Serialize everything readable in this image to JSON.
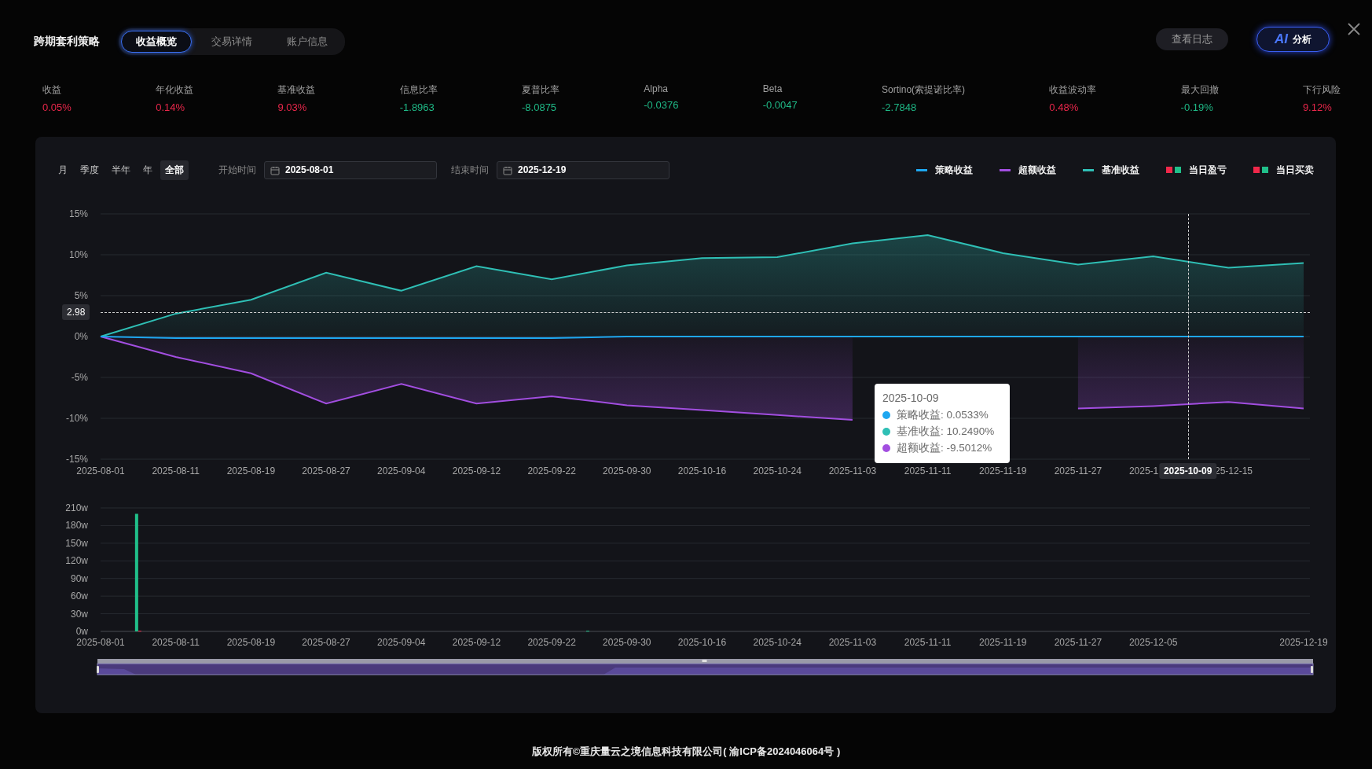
{
  "header": {
    "title": "跨期套利策略",
    "tabs": [
      {
        "label": "收益概览",
        "selected": true
      },
      {
        "label": "交易详情",
        "selected": false
      },
      {
        "label": "账户信息",
        "selected": false
      }
    ],
    "log_button": "查看日志",
    "ai_button": {
      "badge": "AI",
      "label": "分析"
    }
  },
  "stats": [
    {
      "label": "收益",
      "value": "0.05%",
      "color": "#e8274b"
    },
    {
      "label": "年化收益",
      "value": "0.14%",
      "color": "#e8274b"
    },
    {
      "label": "基准收益",
      "value": "9.03%",
      "color": "#e8274b"
    },
    {
      "label": "信息比率",
      "value": "-1.8963",
      "color": "#1fb886"
    },
    {
      "label": "夏普比率",
      "value": "-8.0875",
      "color": "#1fb886"
    },
    {
      "label": "Alpha",
      "value": "-0.0376",
      "color": "#1fb886"
    },
    {
      "label": "Beta",
      "value": "-0.0047",
      "color": "#1fb886"
    },
    {
      "label": "Sortino(索提诺比率)",
      "value": "-2.7848",
      "color": "#1fb886"
    },
    {
      "label": "收益波动率",
      "value": "0.48%",
      "color": "#e8274b"
    },
    {
      "label": "最大回撤",
      "value": "-0.19%",
      "color": "#1fb886"
    },
    {
      "label": "下行风险",
      "value": "9.12%",
      "color": "#e8274b"
    }
  ],
  "panel": {
    "periods": [
      {
        "label": "月",
        "selected": false
      },
      {
        "label": "季度",
        "selected": false
      },
      {
        "label": "半年",
        "selected": false
      },
      {
        "label": "年",
        "selected": false
      },
      {
        "label": "全部",
        "selected": true
      }
    ],
    "start": {
      "label": "开始时间",
      "value": "2025-08-01"
    },
    "end": {
      "label": "结束时间",
      "value": "2025-12-19"
    },
    "legend": [
      {
        "label": "当日盈亏",
        "kind": "squares"
      },
      {
        "label": "当日买卖",
        "kind": "squares"
      }
    ],
    "returns": {
      "chart_data": {
        "type": "area",
        "grid": true,
        "categories": [
          "2025-08-01",
          "2025-08-11",
          "2025-08-19",
          "2025-08-27",
          "2025-09-04",
          "2025-09-12",
          "2025-09-22",
          "2025-09-30",
          "2025-10-16",
          "2025-10-24",
          "2025-11-03",
          "2025-11-11",
          "2025-11-19",
          "2025-11-27",
          "2025-1",
          "25-12-15",
          null
        ],
        "ylim": [
          -15,
          15
        ],
        "yticks": [
          {
            "value": 15,
            "label": "15%"
          },
          {
            "value": 10,
            "label": "10%"
          },
          {
            "value": 5,
            "label": "5%"
          },
          {
            "value": 0,
            "label": "0%"
          },
          {
            "value": -5,
            "label": "-5%"
          },
          {
            "value": -10,
            "label": "-10%"
          },
          {
            "value": -15,
            "label": "-15%"
          }
        ],
        "series": [
          {
            "name": "策略收益",
            "color": "#1ea7f0",
            "values": [
              0,
              -0.2,
              -0.2,
              -0.2,
              -0.2,
              -0.2,
              -0.2,
              0,
              0,
              0,
              0,
              0,
              0,
              0,
              0,
              0,
              0
            ]
          },
          {
            "name": "超额收益",
            "color": "#a24ee0",
            "values": [
              0,
              -2.5,
              -4.5,
              -8.2,
              -5.8,
              -8.2,
              -7.3,
              -8.4,
              -9.0,
              -9.6,
              -10.2,
              null,
              null,
              -8.8,
              -8.5,
              -8.0,
              -8.8
            ]
          },
          {
            "name": "基准收益",
            "color": "#2fbfb5",
            "values": [
              0,
              2.8,
              4.5,
              7.8,
              5.6,
              8.6,
              7.0,
              8.7,
              9.6,
              9.7,
              11.4,
              12.4,
              10.2,
              8.8,
              9.8,
              8.4,
              9.0
            ]
          }
        ]
      },
      "pointer": {
        "x_label": "2025-10-09",
        "y_label": "2.98"
      },
      "tooltip": {
        "title": "2025-10-09",
        "items": [
          {
            "label": "策略收益: 0.0533%",
            "color": "#1ea7f0"
          },
          {
            "label": "基准收益: 10.2490%",
            "color": "#2fbfb5"
          },
          {
            "label": "超额收益: -9.5012%",
            "color": "#a24ee0"
          }
        ]
      }
    },
    "trades": {
      "chart_data": {
        "type": "bar",
        "grid": true,
        "categories": [
          "2025-08-01",
          null,
          "2025-08-11",
          null,
          "2025-08-19",
          null,
          "2025-08-27",
          null,
          "2025-09-04",
          null,
          "2025-09-12",
          null,
          "2025-09-22",
          null,
          "2025-09-30",
          null,
          "2025-10-16",
          null,
          "2025-10-24",
          null,
          "2025-11-03",
          null,
          "2025-11-11",
          null,
          "2025-11-19",
          null,
          "2025-11-27",
          null,
          "2025-12-05",
          null,
          null,
          null,
          "2025-12-19"
        ],
        "ylim": [
          0,
          210
        ],
        "yticks": [
          {
            "value": 210,
            "label": "210w"
          },
          {
            "value": 180,
            "label": "180w"
          },
          {
            "value": 150,
            "label": "150w"
          },
          {
            "value": 120,
            "label": "120w"
          },
          {
            "value": 90,
            "label": "90w"
          },
          {
            "value": 60,
            "label": "60w"
          },
          {
            "value": 30,
            "label": "30w"
          },
          {
            "value": 0,
            "label": "0w"
          }
        ],
        "series": [
          {
            "color": "#20c08a",
            "values": [
              null,
              200,
              null,
              null,
              null,
              null,
              null,
              null,
              null,
              null,
              null,
              null,
              null,
              1,
              null,
              null,
              null,
              null,
              null,
              null,
              null,
              null,
              null,
              null,
              null,
              null,
              null,
              null,
              null,
              null,
              null,
              null,
              null
            ]
          },
          {
            "color": "#f0284a",
            "values": [
              null,
              1,
              null,
              null,
              null,
              null,
              null,
              null,
              null,
              null,
              null,
              null,
              null,
              null,
              null,
              null,
              null,
              null,
              null,
              null,
              null,
              null,
              null,
              null,
              null,
              null,
              null,
              null,
              null,
              null,
              null,
              null,
              null
            ]
          }
        ]
      }
    },
    "range": {
      "level": 1
    }
  },
  "footer": "版权所有©重庆量云之境信息科技有限公司( 渝ICP备2024046064号 )"
}
